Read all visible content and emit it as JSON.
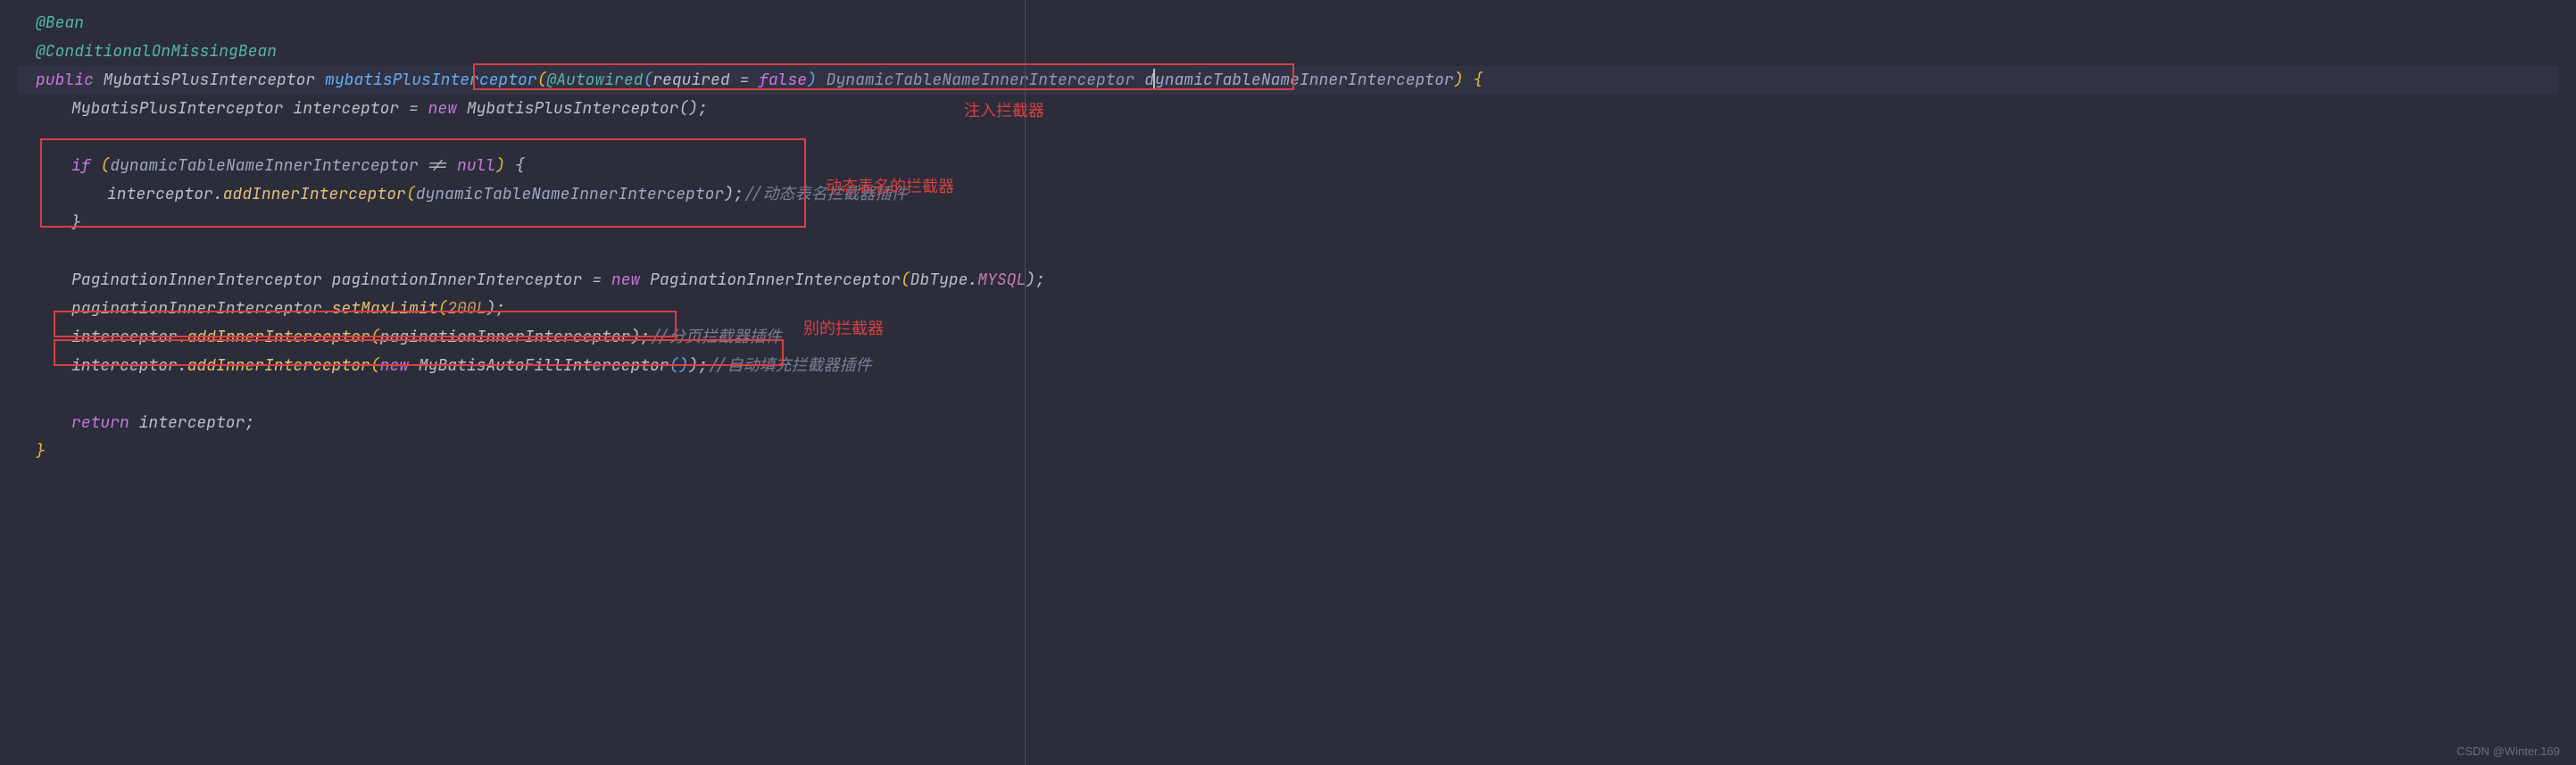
{
  "lines": {
    "l0_bean": "@Bean",
    "l1_cond": "@ConditionalOnMissingBean",
    "l2": {
      "public": "public ",
      "type": "MybatisPlusInterceptor ",
      "method": "mybatisPlusInterceptor",
      "open": "(",
      "autowired": "@Autowired",
      "ao_open": "(",
      "required": "required ",
      "eq": "= ",
      "false": "false",
      "ao_close": ") ",
      "ptype": "DynamicTableNameInnerInterceptor ",
      "pname": "dynamicTableNameInnerInterceptor",
      "close": ")",
      "sp": " ",
      "brace": "{"
    },
    "l3": {
      "type": "MybatisPlusInterceptor ",
      "var": "interceptor ",
      "eq": "= ",
      "new": "new ",
      "ctor": "MybatisPlusInterceptor",
      "p": "();"
    },
    "l5": {
      "if": "if ",
      "open": "(",
      "param": "dynamicTableNameInnerInterceptor ",
      "ne": "!= ",
      "null": "null",
      "close": ") ",
      "brace": "{"
    },
    "l6": {
      "var": "interceptor",
      "dot": ".",
      "method": "addInnerInterceptor",
      "open": "(",
      "arg": "dynamicTableNameInnerInterceptor",
      "close": ");",
      "comment": "//动态表名拦截器插件"
    },
    "l7_brace": "}",
    "l9": {
      "type": "PaginationInnerInterceptor ",
      "var": "paginationInnerInterceptor ",
      "eq": "= ",
      "new": "new ",
      "ctor": "PaginationInnerInterceptor",
      "open": "(",
      "enum": "DbType",
      "dot": ".",
      "val": "MYSQL",
      "close": ");"
    },
    "l10": {
      "var": "paginationInnerInterceptor",
      "dot": ".",
      "method": "setMaxLimit",
      "open": "(",
      "num": "200L",
      "close": ");"
    },
    "l11": {
      "var": "interceptor",
      "dot": ".",
      "method": "addInnerInterceptor",
      "open": "(",
      "arg": "paginationInnerInterceptor",
      "close": ");",
      "comment": "//分页拦截器插件"
    },
    "l12": {
      "var": "interceptor",
      "dot": ".",
      "method": "addInnerInterceptor",
      "open": "(",
      "new": "new ",
      "ctor": "MyBatisAutoFillInterceptor",
      "p": "()",
      "close": ");",
      "comment": "//自动填充拦截器插件"
    },
    "l14": {
      "return": "return ",
      "var": "interceptor;"
    },
    "l15_brace": "}"
  },
  "labels": {
    "inject": "注入拦截器",
    "dynamic": "动态表名的拦截器",
    "other": "别的拦截器"
  },
  "watermark": "CSDN @Winter.169"
}
